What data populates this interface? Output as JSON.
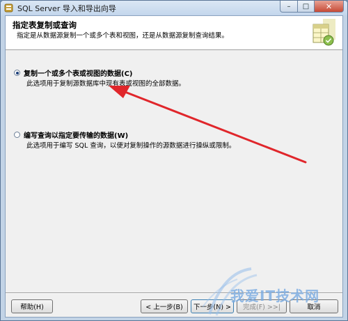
{
  "window": {
    "title": "SQL Server 导入和导出向导",
    "min_glyph": "–",
    "max_glyph": "□",
    "close_glyph": "✕"
  },
  "header": {
    "title": "指定表复制或查询",
    "subtitle": "指定是从数据源复制一个或多个表和视图，还是从数据源复制查询结果。"
  },
  "options": [
    {
      "label": "复制一个或多个表或视图的数据(C)",
      "description": "此选项用于复制源数据库中现有表或视图的全部数据。",
      "checked": true
    },
    {
      "label": "编写查询以指定要传输的数据(W)",
      "description": "此选项用于编写 SQL 查询，以便对复制操作的源数据进行操纵或限制。",
      "checked": false
    }
  ],
  "buttons": {
    "help": "帮助(H)",
    "back": "< 上一步(B)",
    "next": "下一步(N) >",
    "finish": "完成(F) >>|",
    "cancel": "取消"
  },
  "watermark": {
    "text": "我爱IT技术网"
  },
  "colors": {
    "annotation_arrow": "#e0262b",
    "title_bar": "#c3d6ec",
    "close_button": "#c74a36"
  }
}
